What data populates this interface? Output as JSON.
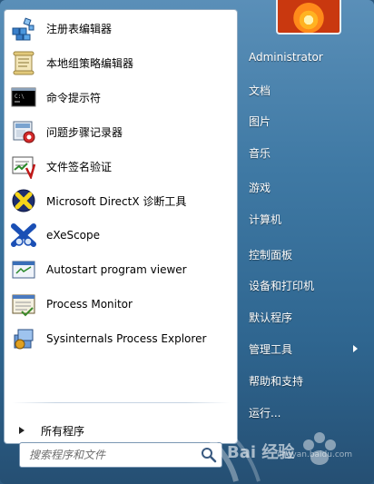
{
  "left_panel": {
    "items": [
      {
        "label": "注册表编辑器",
        "icon": "registry-editor-icon"
      },
      {
        "label": "本地组策略编辑器",
        "icon": "group-policy-editor-icon"
      },
      {
        "label": "命令提示符",
        "icon": "command-prompt-icon"
      },
      {
        "label": "问题步骤记录器",
        "icon": "steps-recorder-icon"
      },
      {
        "label": "文件签名验证",
        "icon": "file-signature-icon"
      },
      {
        "label": "Microsoft DirectX 诊断工具",
        "icon": "directx-icon"
      },
      {
        "label": "eXeScope",
        "icon": "exescope-icon"
      },
      {
        "label": "Autostart program viewer",
        "icon": "autostart-viewer-icon"
      },
      {
        "label": "Process Monitor",
        "icon": "process-monitor-icon"
      },
      {
        "label": "Sysinternals Process Explorer",
        "icon": "process-explorer-icon"
      }
    ],
    "all_programs": "所有程序",
    "search_placeholder": "搜索程序和文件"
  },
  "right_panel": {
    "items": [
      {
        "label": "Administrator"
      },
      {
        "label": "文档"
      },
      {
        "label": "图片"
      },
      {
        "label": "音乐"
      },
      {
        "label": "游戏"
      },
      {
        "label": "计算机"
      },
      {
        "label": "控制面板"
      },
      {
        "label": "设备和打印机"
      },
      {
        "label": "默认程序"
      },
      {
        "label": "管理工具"
      },
      {
        "label": "帮助和支持"
      },
      {
        "label": "运行..."
      }
    ]
  },
  "watermark": {
    "text": "Bai 经验",
    "url": "jingyan.baidu.com"
  },
  "colors": {
    "menu_blue": "#3f79a4",
    "left_panel_bg": "#ffffff",
    "right_text": "#ffffff"
  }
}
